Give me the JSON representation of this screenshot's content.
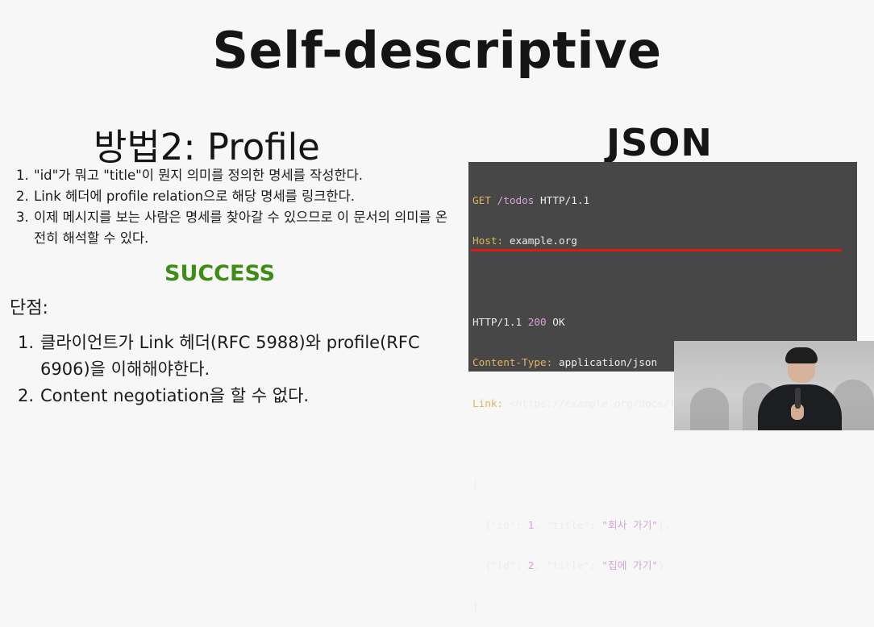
{
  "slide": {
    "title": "Self-descriptive",
    "left_heading": "방법2: Profile",
    "right_heading": "JSON",
    "steps": [
      {
        "num": "1.",
        "text": "\"id\"가 뭐고 \"title\"이 뭔지 의미를 정의한 명세를 작성한다."
      },
      {
        "num": "2.",
        "text": "Link 헤더에 profile relation으로 해당 명세를 링크한다."
      },
      {
        "num": "3.",
        "text": "이제 메시지를 보는 사람은 명세를 찾아갈 수 있으므로 이 문서의 의미를 온전히 해석할 수 있다."
      }
    ],
    "success": "SUCCESS",
    "cons_title": "단점:",
    "cons": [
      {
        "num": "1.",
        "text": "클라이언트가 Link 헤더(RFC 5988)와 profile(RFC 6906)을 이해해야한다."
      },
      {
        "num": "2.",
        "text": "Content negotiation을 할 수 없다."
      }
    ],
    "colors": {
      "success": "#3f8d17",
      "terminal_bg": "#474747",
      "underline": "#e01818"
    }
  },
  "terminal": {
    "request_method": "GET",
    "request_path": "/todos",
    "request_proto": " HTTP/1.1",
    "host_key": "Host:",
    "host_val": " example.org",
    "status_proto": "HTTP/1.1 ",
    "status_code": "200",
    "status_text": " OK",
    "ctype_key": "Content-Type:",
    "ctype_val": " application/json",
    "link_key": "Link:",
    "link_val": " <https://example.org/docs/todos>; rel=\"profile\"",
    "open_bracket": "[",
    "row1_a": "  {\"id\": ",
    "row1_id": "1",
    "row1_b": ", \"title\": ",
    "row1_title": "\"회사 가기\"",
    "row1_c": "},",
    "row2_a": "  {\"id\": ",
    "row2_id": "2",
    "row2_b": ", \"title\": ",
    "row2_title": "\"집에 가기\"",
    "row2_c": "}",
    "close_bracket": "]"
  }
}
